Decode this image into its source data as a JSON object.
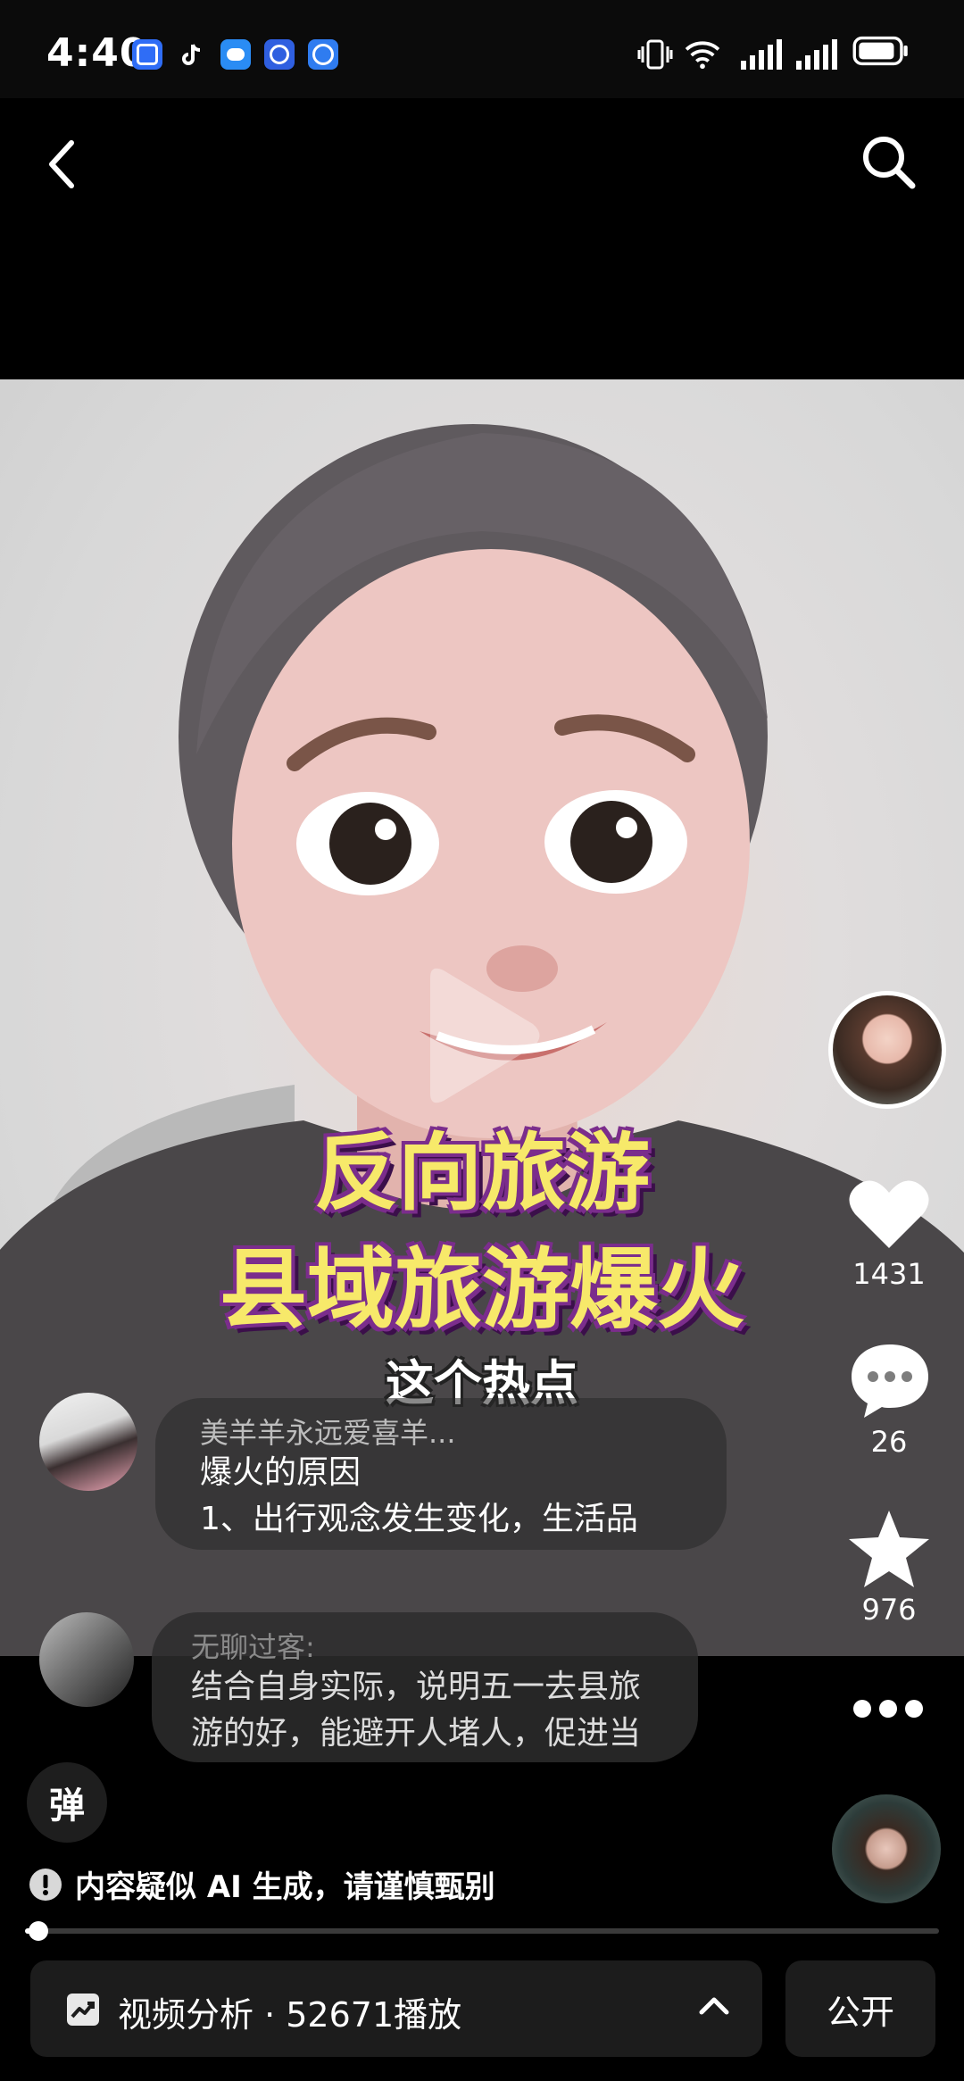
{
  "status_bar": {
    "time": "4:40"
  },
  "header": {
    "back_icon": "chevron-left-icon",
    "search_icon": "search-icon"
  },
  "video": {
    "title_line1": "反向旅游",
    "title_line2": "县域旅游爆火",
    "subtitle": "这个热点"
  },
  "comments": [
    {
      "name": "美羊羊永远爱喜羊...",
      "text_line1": "爆火的原因",
      "text_line2": "1、出行观念发生变化，生活品"
    },
    {
      "name": "无聊过客:",
      "text_line1": "结合自身实际，说明五一去县旅",
      "text_line2": "游的好，能避开人堵人，促进当"
    }
  ],
  "actions": {
    "likes": "1431",
    "comments": "26",
    "favorites": "976"
  },
  "danmaku_icon": "弹",
  "ai_notice": "内容疑似 AI 生成，请谨慎甄别",
  "progress": 0.01,
  "bottom_bar": {
    "analysis_label": "视频分析 · 52671播放",
    "public_label": "公开"
  },
  "colors": {
    "title_yellow": "#f7e96a",
    "title_outline": "#7b2d8c",
    "background": "#000000"
  }
}
